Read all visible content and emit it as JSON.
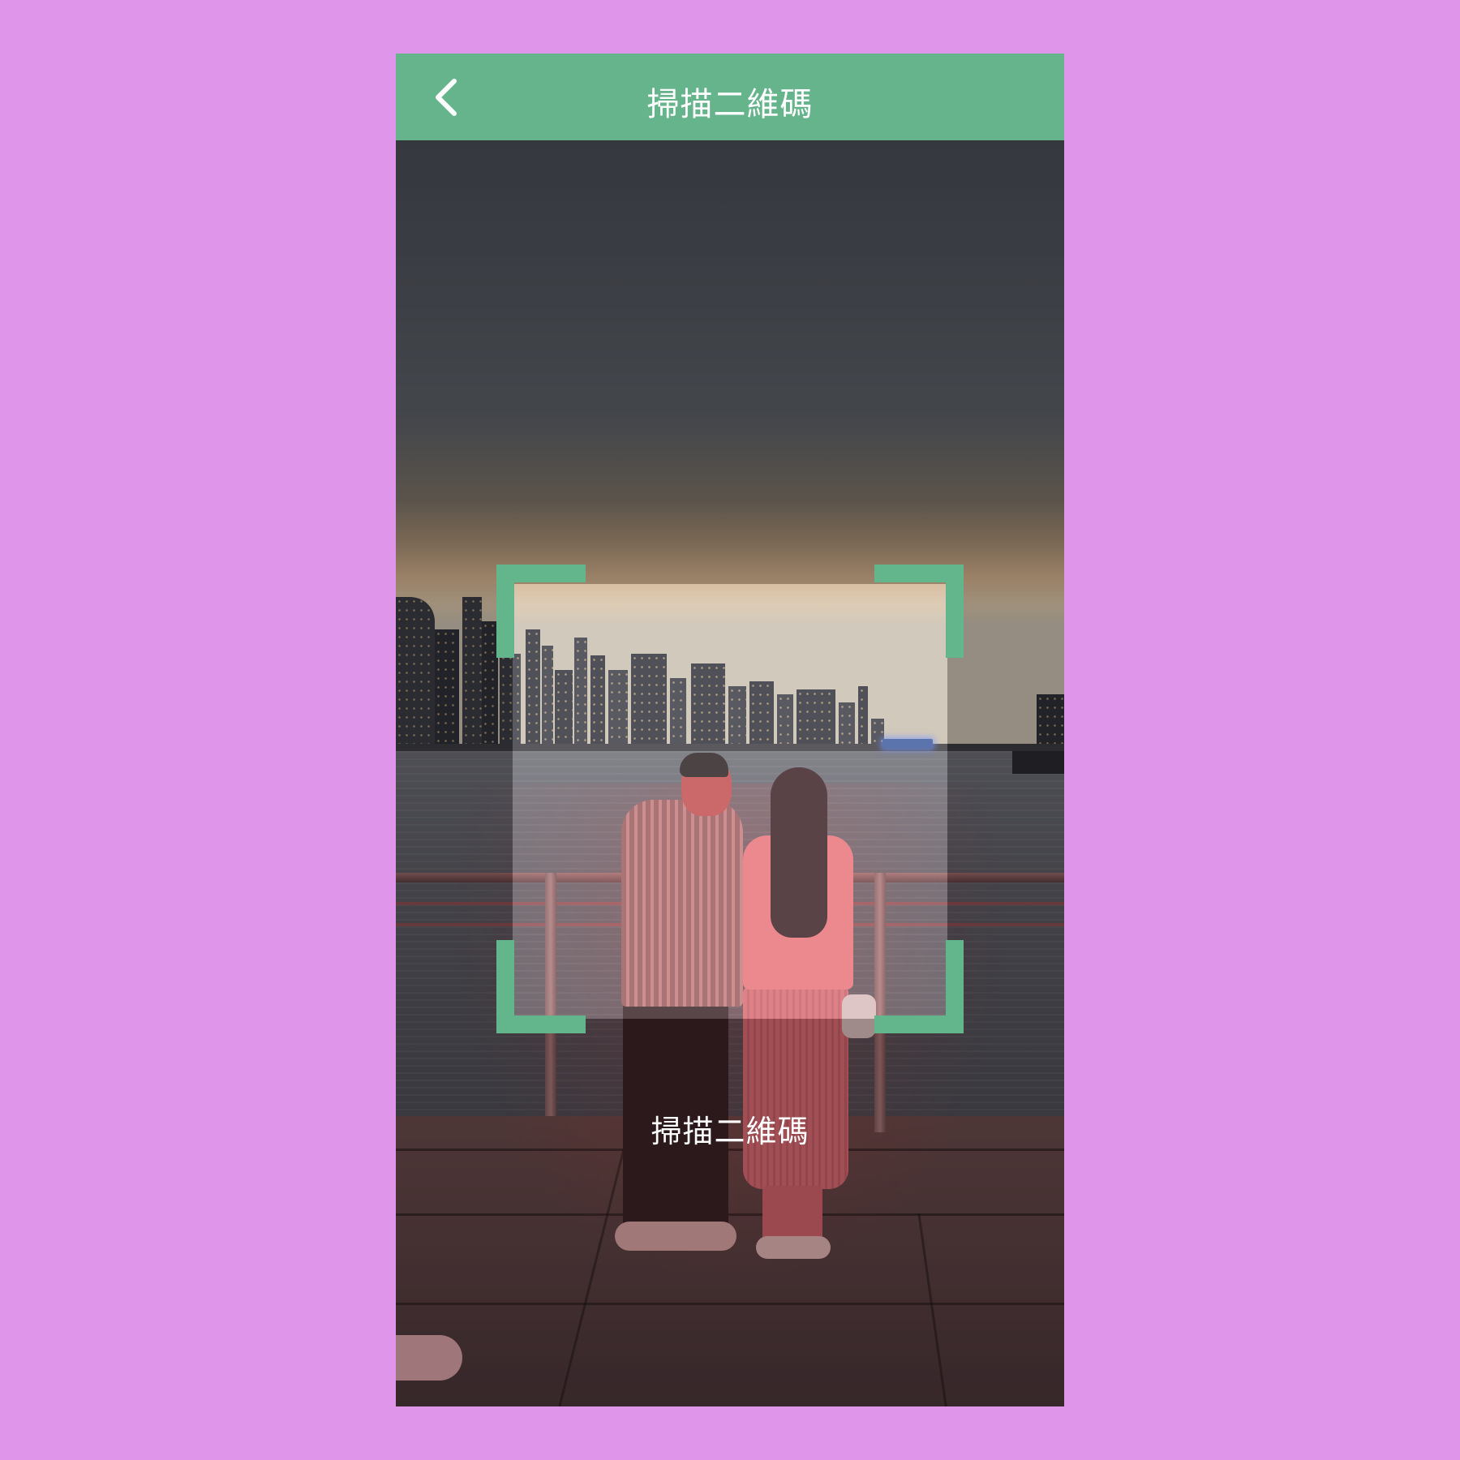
{
  "header": {
    "title": "掃描二維碼",
    "back_icon": "chevron-left-icon"
  },
  "scanner": {
    "hint": "掃描二維碼",
    "frame_color": "#63b58c"
  },
  "colors": {
    "background": "#de95ea",
    "header": "#66b48c",
    "text": "#ffffff"
  }
}
